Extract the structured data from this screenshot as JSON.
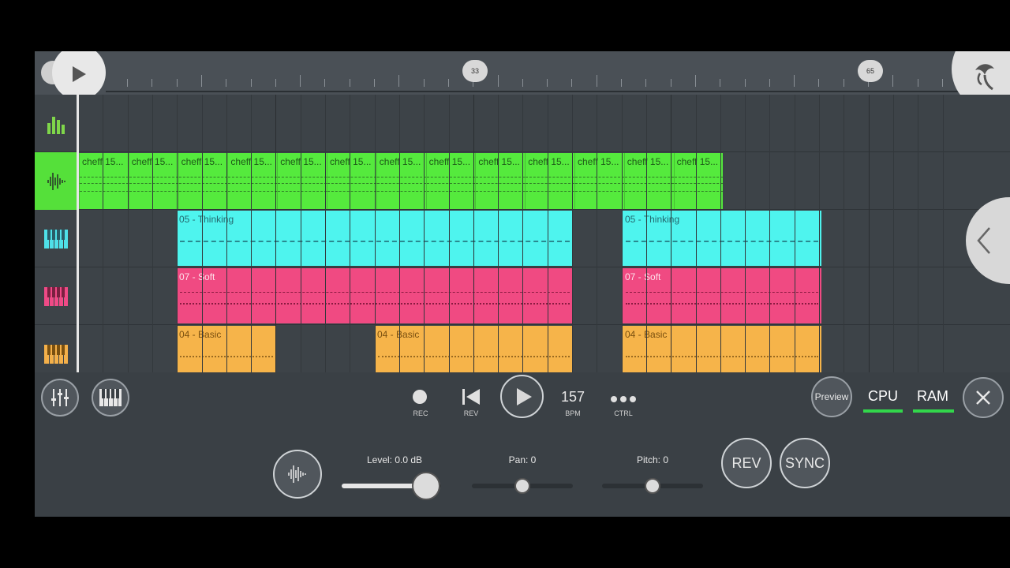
{
  "ruler": {
    "markers": [
      "33",
      "65"
    ]
  },
  "tracks": [
    {
      "icon": "mixer-bars-icon",
      "color": "#7fd64a"
    },
    {
      "icon": "waveform-icon",
      "color": "#55e03a",
      "active": true
    },
    {
      "icon": "piano-icon",
      "color": "#4fe0e8"
    },
    {
      "icon": "piano-icon",
      "color": "#ef4a86"
    },
    {
      "icon": "piano-icon",
      "color": "#f4b04a"
    }
  ],
  "clips": {
    "audio_label": "cheff 15...",
    "audio_count": 13,
    "thinking": "05 - Thinking",
    "soft": "07 - Soft",
    "basic": "04 - Basic"
  },
  "colors": {
    "audio": "#55ea3d",
    "thinking": "#4ef4ee",
    "soft": "#f04a82",
    "basic": "#f6b44a"
  },
  "toolbar": {
    "rec": "REC",
    "rev": "REV",
    "bpm_value": "157",
    "bpm_label": "BPM",
    "ctrl_label": "CTRL",
    "preview": "Preview",
    "cpu": "CPU",
    "ram": "RAM"
  },
  "sample_panel": {
    "level": "Level: 0.0 dB",
    "level_fraction": 0.85,
    "pan": "Pan: 0",
    "pitch": "Pitch: 0",
    "rev_button": "REV",
    "sync_button": "SYNC"
  }
}
